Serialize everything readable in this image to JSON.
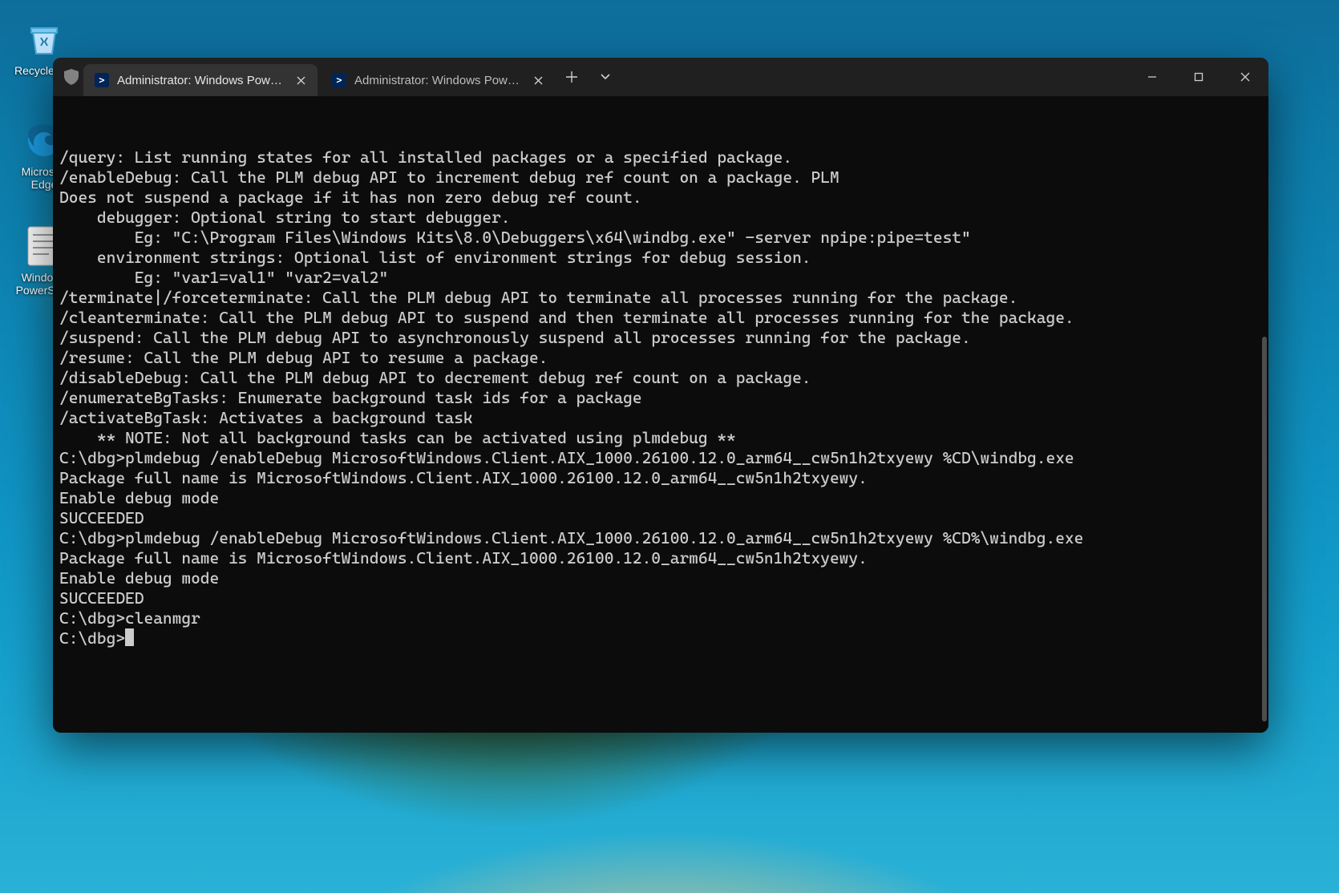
{
  "desktopIcons": {
    "recycle": "Recycle Bin",
    "edge": "Microsoft Edge",
    "notepad": "Windows PowerShell"
  },
  "tabs": [
    {
      "label": "Administrator: Windows PowerShell",
      "active": true
    },
    {
      "label": "Administrator: Windows PowerShell",
      "active": false
    }
  ],
  "newTabTooltip": "New tab",
  "tabMenuTooltip": "Tab options",
  "terminalLines": [
    "/query: List running states for all installed packages or a specified package.",
    "/enableDebug: Call the PLM debug API to increment debug ref count on a package. PLM",
    "Does not suspend a package if it has non zero debug ref count.",
    "    debugger: Optional string to start debugger.",
    "        Eg: \"C:\\Program Files\\Windows Kits\\8.0\\Debuggers\\x64\\windbg.exe\" -server npipe:pipe=test\"",
    "    environment strings: Optional list of environment strings for debug session.",
    "        Eg: \"var1=val1\" \"var2=val2\"",
    "/terminate|/forceterminate: Call the PLM debug API to terminate all processes running for the package.",
    "/cleanterminate: Call the PLM debug API to suspend and then terminate all processes running for the package.",
    "/suspend: Call the PLM debug API to asynchronously suspend all processes running for the package.",
    "/resume: Call the PLM debug API to resume a package.",
    "/disableDebug: Call the PLM debug API to decrement debug ref count on a package.",
    "/enumerateBgTasks: Enumerate background task ids for a package",
    "/activateBgTask: Activates a background task",
    "    ** NOTE: Not all background tasks can be activated using plmdebug **",
    "",
    "C:\\dbg>plmdebug /enableDebug MicrosoftWindows.Client.AIX_1000.26100.12.0_arm64__cw5n1h2txyewy %CD\\windbg.exe",
    "Package full name is MicrosoftWindows.Client.AIX_1000.26100.12.0_arm64__cw5n1h2txyewy.",
    "Enable debug mode",
    "SUCCEEDED",
    "",
    "C:\\dbg>plmdebug /enableDebug MicrosoftWindows.Client.AIX_1000.26100.12.0_arm64__cw5n1h2txyewy %CD%\\windbg.exe",
    "Package full name is MicrosoftWindows.Client.AIX_1000.26100.12.0_arm64__cw5n1h2txyewy.",
    "Enable debug mode",
    "SUCCEEDED",
    "",
    "C:\\dbg>cleanmgr",
    "",
    "C:\\dbg>"
  ]
}
